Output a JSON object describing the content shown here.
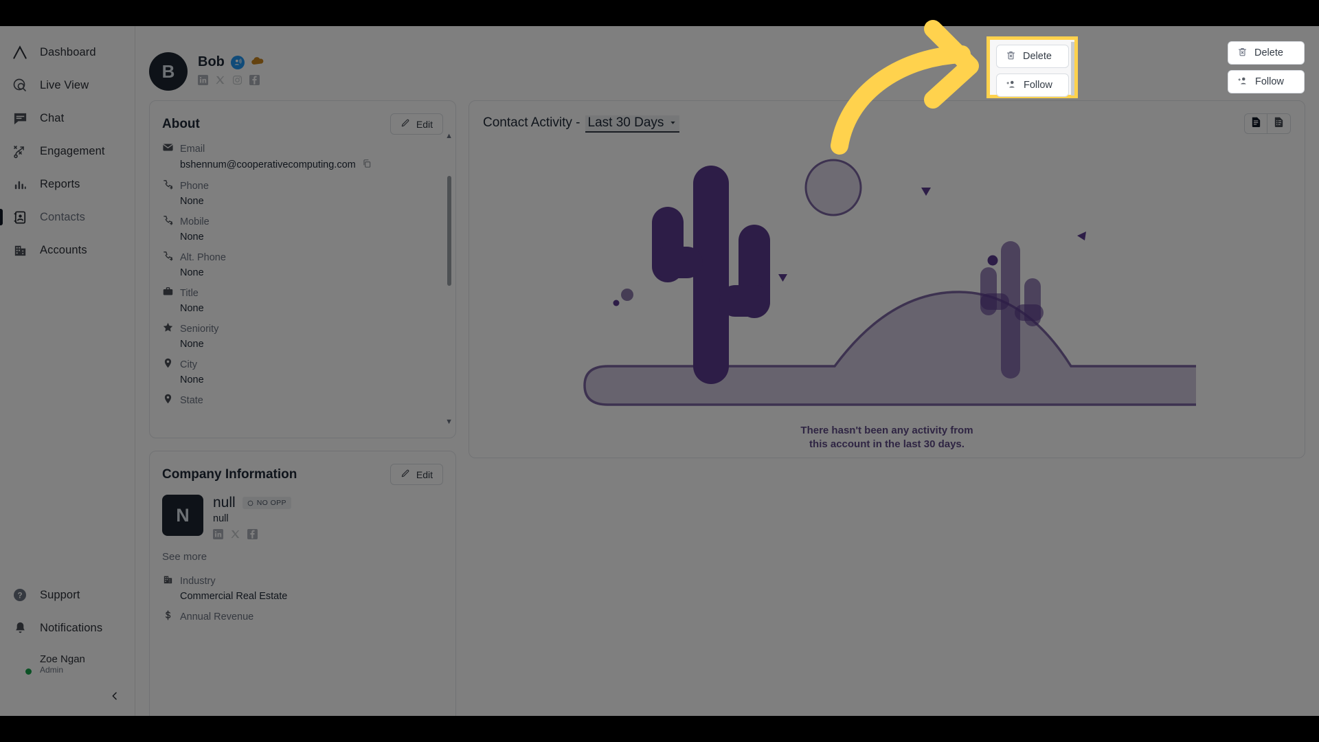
{
  "sidebar": {
    "items": [
      {
        "label": "Dashboard",
        "icon": "logo-chevron-icon",
        "active": false
      },
      {
        "label": "Live View",
        "icon": "live-view-icon",
        "active": false
      },
      {
        "label": "Chat",
        "icon": "chat-icon",
        "active": false
      },
      {
        "label": "Engagement",
        "icon": "engagement-icon",
        "active": false
      },
      {
        "label": "Reports",
        "icon": "reports-bar-icon",
        "active": false
      },
      {
        "label": "Contacts",
        "icon": "contacts-card-icon",
        "active": true
      },
      {
        "label": "Accounts",
        "icon": "accounts-building-icon",
        "active": false
      }
    ],
    "bottom": [
      {
        "label": "Support",
        "icon": "help-circle-icon"
      },
      {
        "label": "Notifications",
        "icon": "bell-icon"
      }
    ],
    "user": {
      "name": "Zoe Ngan",
      "role": "Admin",
      "status": "online"
    },
    "collapse_label": "‹"
  },
  "profile": {
    "avatar_initial": "B",
    "name": "Bob",
    "badges": [
      "broadcast-badge-icon",
      "cloud-brand-icon"
    ],
    "socials": [
      "linkedin-icon",
      "x-icon",
      "instagram-icon",
      "facebook-icon"
    ]
  },
  "actions": {
    "delete_label": "Delete",
    "follow_label": "Follow"
  },
  "about": {
    "title": "About",
    "edit_label": "Edit",
    "fields": [
      {
        "label": "Email",
        "value": "bshennum@cooperativecomputing.com",
        "icon": "mail-icon",
        "copyable": true
      },
      {
        "label": "Phone",
        "value": "None",
        "icon": "phone-icon",
        "copyable": false
      },
      {
        "label": "Mobile",
        "value": "None",
        "icon": "phone-icon",
        "copyable": false
      },
      {
        "label": "Alt. Phone",
        "value": "None",
        "icon": "phone-icon",
        "copyable": false
      },
      {
        "label": "Title",
        "value": "None",
        "icon": "briefcase-icon",
        "copyable": false
      },
      {
        "label": "Seniority",
        "value": "None",
        "icon": "star-icon",
        "copyable": false
      },
      {
        "label": "City",
        "value": "None",
        "icon": "pin-icon",
        "copyable": false
      },
      {
        "label": "State",
        "value": "",
        "icon": "pin-icon",
        "copyable": false
      }
    ]
  },
  "company": {
    "title": "Company Information",
    "edit_label": "Edit",
    "logo_initial": "N",
    "name": "null",
    "opp_badge": "NO OPP",
    "subtitle": "null",
    "socials": [
      "linkedin-icon",
      "x-icon",
      "facebook-icon"
    ],
    "see_more_label": "See more",
    "fields": [
      {
        "label": "Industry",
        "value": "Commercial Real Estate",
        "icon": "building-icon"
      },
      {
        "label": "Annual Revenue",
        "value": "",
        "icon": "revenue-icon"
      }
    ]
  },
  "activity": {
    "title_prefix": "Contact Activity -",
    "range_value": "Last 30 Days",
    "view_buttons": [
      "list-view-icon",
      "detail-view-icon"
    ],
    "empty_line1": "There hasn't been any activity from",
    "empty_line2": "this account in the last 30 days."
  },
  "annotation": {
    "arrow": "curved-arrow-pointing-right",
    "highlight_color": "#ffd24d"
  },
  "colors": {
    "accent_purple": "#5b3a8e",
    "accent_purple_light": "#8d7aab",
    "highlight_yellow": "#ffd24d",
    "online_green": "#16a34a",
    "badge_blue": "#2196f3"
  }
}
